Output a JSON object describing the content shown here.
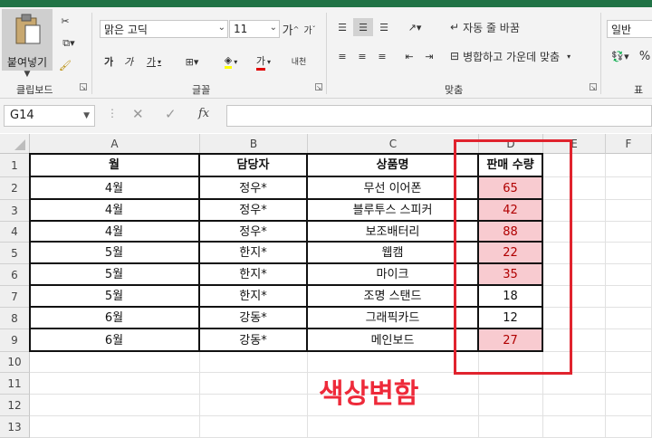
{
  "ribbon": {
    "clipboard": {
      "paste_label": "붙여넣기",
      "group_label": "클립보드"
    },
    "font": {
      "font_name": "맑은 고딕",
      "font_size": "11",
      "grow_label": "가",
      "shrink_label": "가",
      "bold_label": "가",
      "italic_label": "가",
      "underline_label": "가",
      "color_label": "가",
      "phonetic_label": "내천",
      "group_label": "글꼴"
    },
    "alignment": {
      "wrap_label": "자동 줄 바꿈",
      "merge_label": "병합하고 가운데 맞춤",
      "group_label": "맞춤"
    },
    "number": {
      "format_value": "일반",
      "percent_label": "%",
      "group_label": "표시"
    }
  },
  "formula_bar": {
    "name_box": "G14",
    "fx_label": "fx",
    "formula": ""
  },
  "columns": [
    "A",
    "B",
    "C",
    "D",
    "E",
    "F"
  ],
  "rows": [
    "1",
    "2",
    "3",
    "4",
    "5",
    "6",
    "7",
    "8",
    "9",
    "10",
    "11",
    "12",
    "13"
  ],
  "table": {
    "headers": [
      "월",
      "담당자",
      "상품명",
      "판매 수량"
    ],
    "data": [
      {
        "month": "4월",
        "person": "정우*",
        "product": "무선 이어폰",
        "qty": "65"
      },
      {
        "month": "4월",
        "person": "정우*",
        "product": "블루투스 스피커",
        "qty": "42"
      },
      {
        "month": "4월",
        "person": "정우*",
        "product": "보조배터리",
        "qty": "88"
      },
      {
        "month": "5월",
        "person": "한지*",
        "product": "웹캠",
        "qty": "22"
      },
      {
        "month": "5월",
        "person": "한지*",
        "product": "마이크",
        "qty": "35"
      },
      {
        "month": "5월",
        "person": "한지*",
        "product": "조명 스탠드",
        "qty": "18"
      },
      {
        "month": "6월",
        "person": "강동*",
        "product": "그래픽카드",
        "qty": "12"
      },
      {
        "month": "6월",
        "person": "강동*",
        "product": "메인보드",
        "qty": "27"
      }
    ],
    "highlight_fill": "#f8cbd0",
    "highlight_text": "#b00000"
  },
  "annotation": {
    "caption": "색상변함",
    "box_color": "#e0232e"
  }
}
